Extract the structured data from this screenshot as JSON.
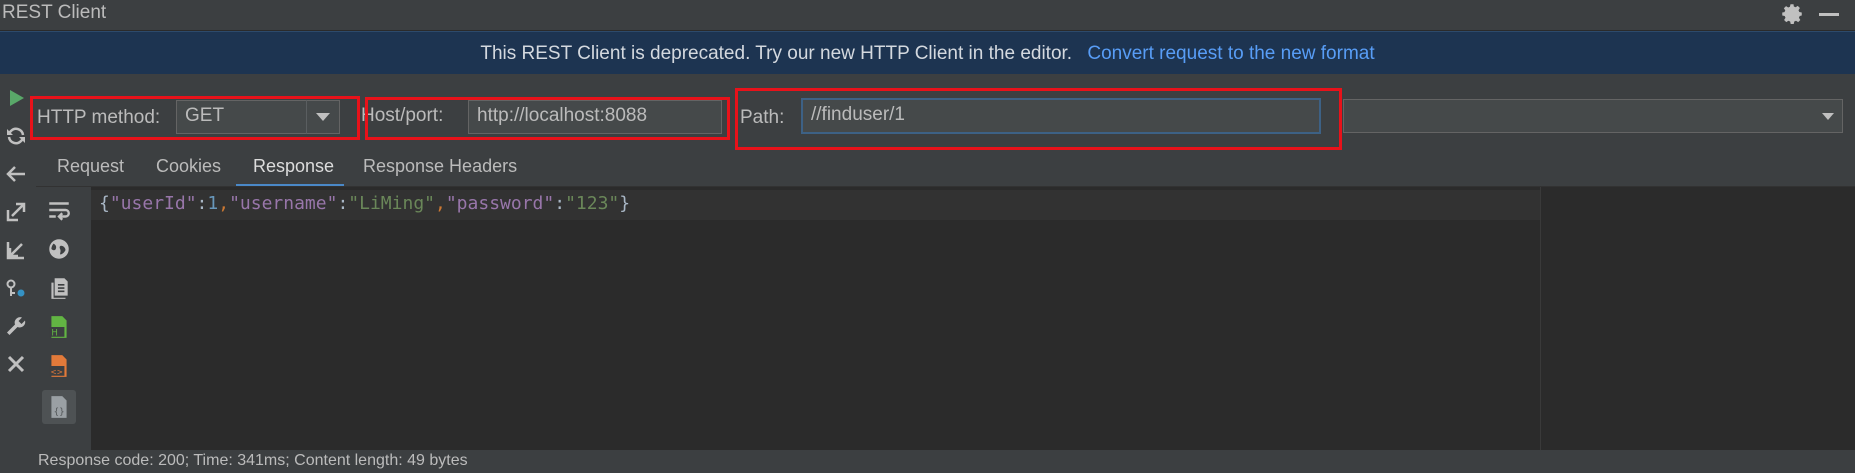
{
  "window": {
    "title": "REST Client"
  },
  "banner": {
    "message": "This REST Client is deprecated. Try our new HTTP Client in the editor.",
    "link": "Convert request to the new format"
  },
  "left_toolbar": {
    "icons": [
      "run-icon",
      "refresh-icon",
      "back-arrow-icon",
      "export-icon",
      "import-icon",
      "cookies-icon",
      "settings-wrench-icon",
      "close-icon"
    ]
  },
  "request": {
    "method_label": "HTTP method:",
    "method_value": "GET",
    "host_label": "Host/port:",
    "host_value": "http://localhost:8088",
    "path_label": "Path:",
    "path_value": "//finduser/1"
  },
  "tabs": [
    {
      "label": "Request"
    },
    {
      "label": "Cookies"
    },
    {
      "label": "Response"
    },
    {
      "label": "Response Headers"
    }
  ],
  "active_tab": "Response",
  "response": {
    "parts": {
      "open": "{",
      "k1": "\"userId\"",
      "c1": ":",
      "v1": "1",
      "s1": ",",
      "k2": "\"username\"",
      "c2": ":",
      "v2": "\"LiMing\"",
      "s2": ",",
      "k3": "\"password\"",
      "c3": ":",
      "v3": "\"123\"",
      "close": "}"
    }
  },
  "status": {
    "text": "Response code: 200; Time: 341ms; Content length: 49 bytes"
  },
  "colors": {
    "highlight": "#e8121a",
    "link": "#589df6",
    "banner_bg": "#1d3451",
    "active_tab": "#4a88c7"
  }
}
